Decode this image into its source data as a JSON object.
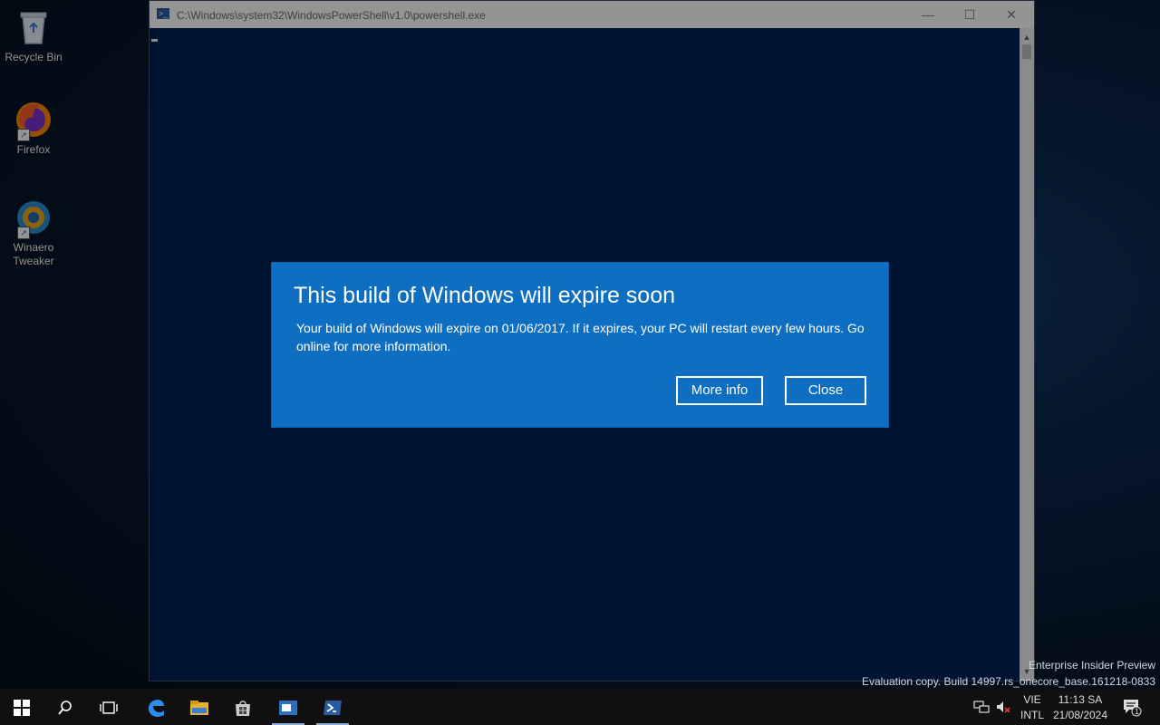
{
  "desktop": {
    "icons": [
      {
        "label": "Recycle Bin",
        "icon": "recycle-bin-icon"
      },
      {
        "label": "Firefox",
        "icon": "firefox-icon"
      },
      {
        "label": "Winaero Tweaker",
        "icon": "winaero-tweaker-icon"
      }
    ]
  },
  "window": {
    "title": "C:\\Windows\\system32\\WindowsPowerShell\\v1.0\\powershell.exe",
    "controls": {
      "minimize": "—",
      "maximize": "☐",
      "close": "✕"
    }
  },
  "dialog": {
    "title": "This build of Windows will expire soon",
    "message": "Your build of Windows will expire on 01/06/2017. If it expires, your PC will restart every few hours. Go online for more information.",
    "more_info": "More info",
    "close": "Close"
  },
  "watermark": {
    "line1": "Enterprise Insider Preview",
    "line2": "Evaluation copy. Build 14997.rs_onecore_base.161218-0833"
  },
  "taskbar": {
    "lang_top": "VIE",
    "lang_bottom": "INTL",
    "time": "11:13 SA",
    "date": "21/08/2024",
    "notifications": "1"
  },
  "colors": {
    "dialog": "#0e6fc2",
    "powershell_bg": "#012456",
    "taskbar": "#101010"
  }
}
